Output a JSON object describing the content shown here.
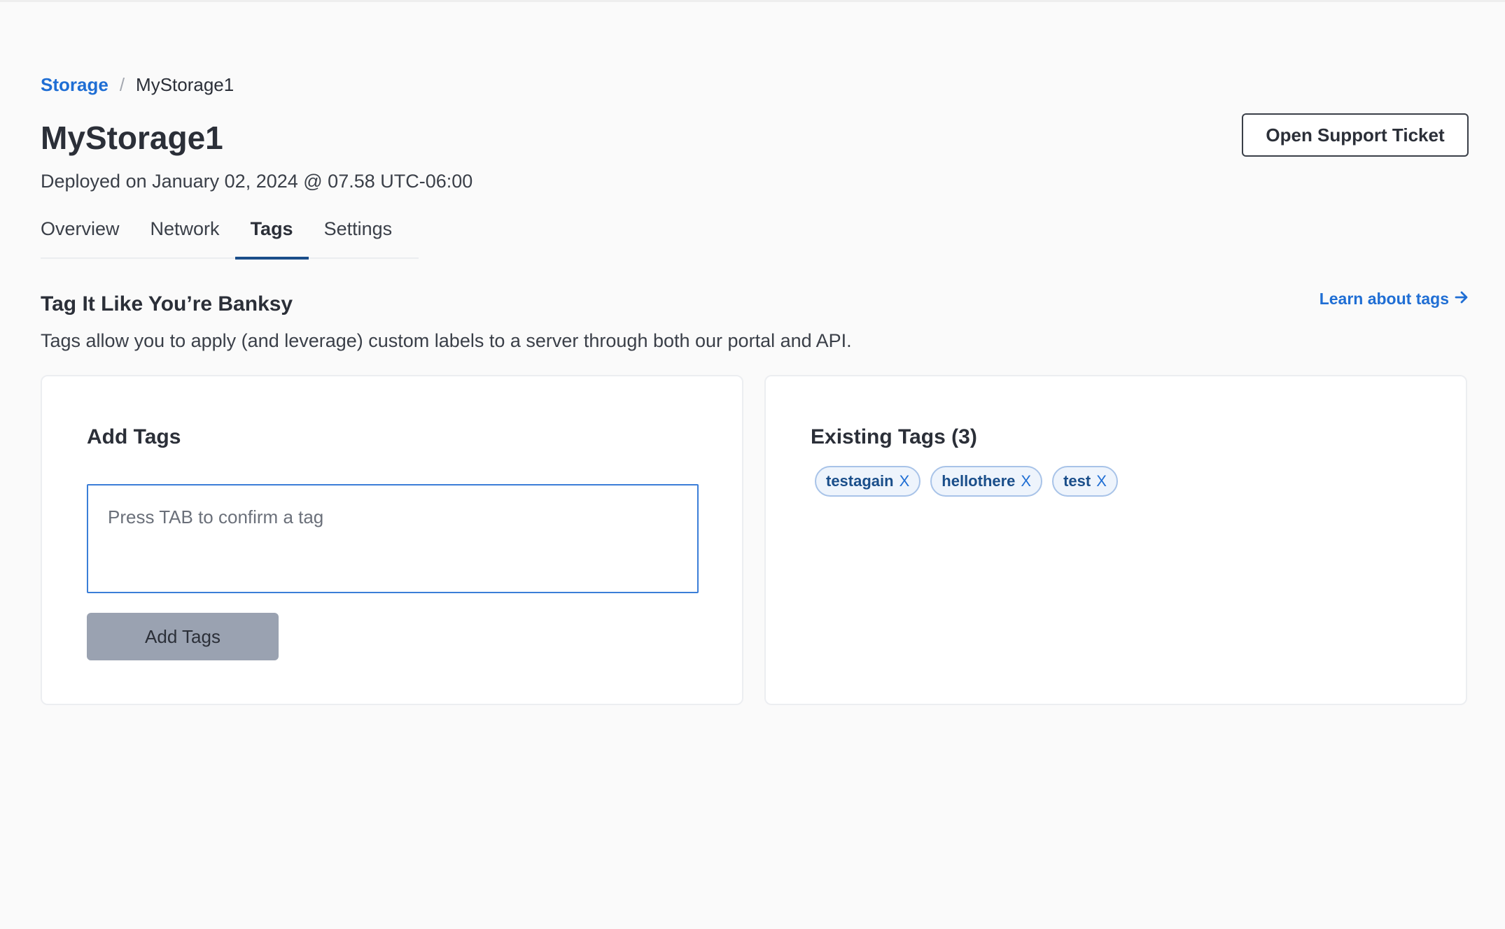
{
  "breadcrumb": {
    "parent": "Storage",
    "separator": "/",
    "current": "MyStorage1"
  },
  "header": {
    "title": "MyStorage1",
    "deployed": "Deployed on January 02, 2024 @ 07.58 UTC-06:00",
    "support_button": "Open Support Ticket"
  },
  "tabs": [
    {
      "label": "Overview",
      "active": false
    },
    {
      "label": "Network",
      "active": false
    },
    {
      "label": "Tags",
      "active": true
    },
    {
      "label": "Settings",
      "active": false
    }
  ],
  "section": {
    "title": "Tag It Like You’re Banksy",
    "description": "Tags allow you to apply (and leverage) custom labels to a server through both our portal and API.",
    "learn_link": "Learn about tags",
    "learn_icon": "arrow-right-icon"
  },
  "add_tags": {
    "title": "Add Tags",
    "input_value": "",
    "input_placeholder": "Press TAB to confirm a tag",
    "button_label": "Add Tags"
  },
  "existing_tags": {
    "title": "Existing Tags (3)",
    "remove_label": "X",
    "tags": [
      "testagain",
      "hellothere",
      "test"
    ]
  },
  "colors": {
    "link": "#1f6ed4",
    "active_tab_underline": "#1a4e8a",
    "disabled_button": "#9aa2b1",
    "chip_border": "#a8c3e8",
    "chip_background": "#eef4fc",
    "input_border": "#3b7ed8"
  }
}
